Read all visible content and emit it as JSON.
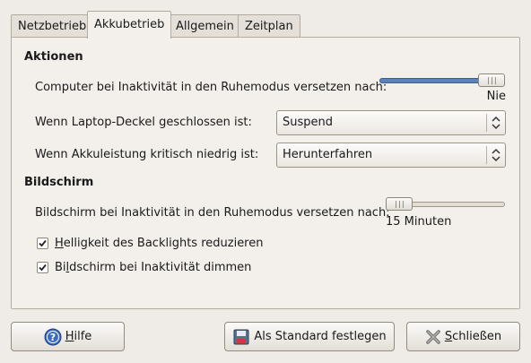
{
  "tabs": [
    {
      "label": "Netzbetrieb",
      "active": false
    },
    {
      "label": "Akkubetrieb",
      "active": true
    },
    {
      "label": "Allgemein",
      "active": false
    },
    {
      "label": "Zeitplan",
      "active": false
    }
  ],
  "actions": {
    "title": "Aktionen",
    "sleep_label": "Computer bei Inaktivität in den Ruhemodus versetzen nach:",
    "sleep_slider": {
      "level": 1.0,
      "value_text": "Nie"
    },
    "lid_label": "Wenn Laptop-Deckel geschlossen ist:",
    "lid_value": "Suspend",
    "critical_label": "Wenn Akkuleistung kritisch niedrig ist:",
    "critical_value": "Herunterfahren"
  },
  "display": {
    "title": "Bildschirm",
    "sleep_label": "Bildschirm bei Inaktivität in den Ruhemodus versetzen nach:",
    "sleep_slider": {
      "level": 0.0,
      "value_text": "15 Minuten"
    },
    "backlight": {
      "checked": true,
      "label": "Helligkeit des Backlights reduzieren"
    },
    "dim": {
      "checked": true,
      "label": "Bildschirm bei Inaktivität dimmen"
    }
  },
  "buttons": {
    "help": "Hilfe",
    "default": "Als Standard festlegen",
    "close": "Schließen"
  },
  "colors": {
    "slider_fill": "#5b82b9",
    "background": "#efebe7"
  },
  "icons": {
    "help": "help-icon",
    "default": "save-disk-icon",
    "close": "close-x-icon"
  }
}
